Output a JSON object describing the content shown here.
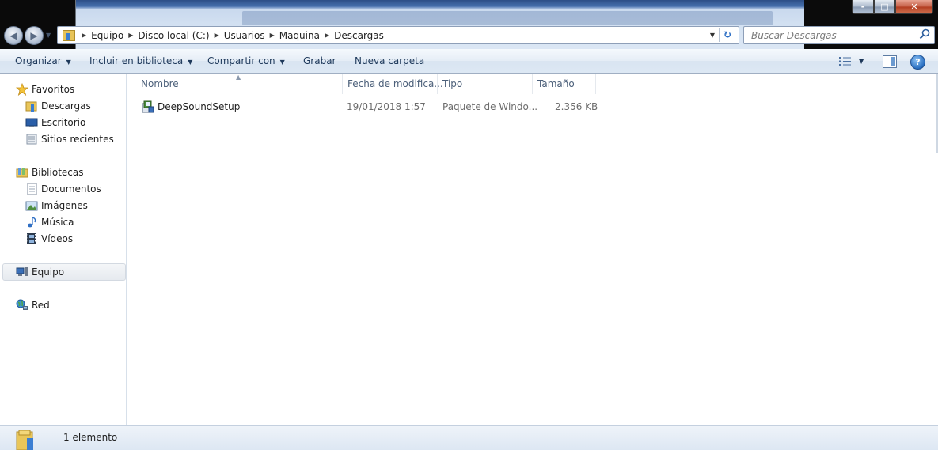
{
  "window": {
    "controls": {
      "minimize": "-",
      "maximize": "□",
      "close": "✕"
    }
  },
  "nav": {
    "back_icon": "back-arrow-icon",
    "forward_icon": "forward-arrow-icon"
  },
  "address": {
    "breadcrumbs": [
      "Equipo",
      "Disco local (C:)",
      "Usuarios",
      "Maquina",
      "Descargas"
    ]
  },
  "search": {
    "placeholder": "Buscar Descargas"
  },
  "toolbar": {
    "organize": "Organizar",
    "include": "Incluir en biblioteca",
    "share": "Compartir con",
    "burn": "Grabar",
    "new_folder": "Nueva carpeta",
    "help": "?"
  },
  "sidebar": {
    "favorites": {
      "label": "Favoritos",
      "items": [
        "Descargas",
        "Escritorio",
        "Sitios recientes"
      ]
    },
    "libraries": {
      "label": "Bibliotecas",
      "items": [
        "Documentos",
        "Imágenes",
        "Música",
        "Vídeos"
      ]
    },
    "computer": "Equipo",
    "network": "Red"
  },
  "columns": {
    "name": "Nombre",
    "date": "Fecha de modifica...",
    "type": "Tipo",
    "size": "Tamaño"
  },
  "files": [
    {
      "name": "DeepSoundSetup",
      "date": "19/01/2018 1:57",
      "type": "Paquete de Windo...",
      "size": "2.356 KB"
    }
  ],
  "status": {
    "count": "1 elemento"
  },
  "colors": {
    "accent": "#1e395b",
    "header_text": "#4c607a",
    "selection": "#e6eaef"
  }
}
